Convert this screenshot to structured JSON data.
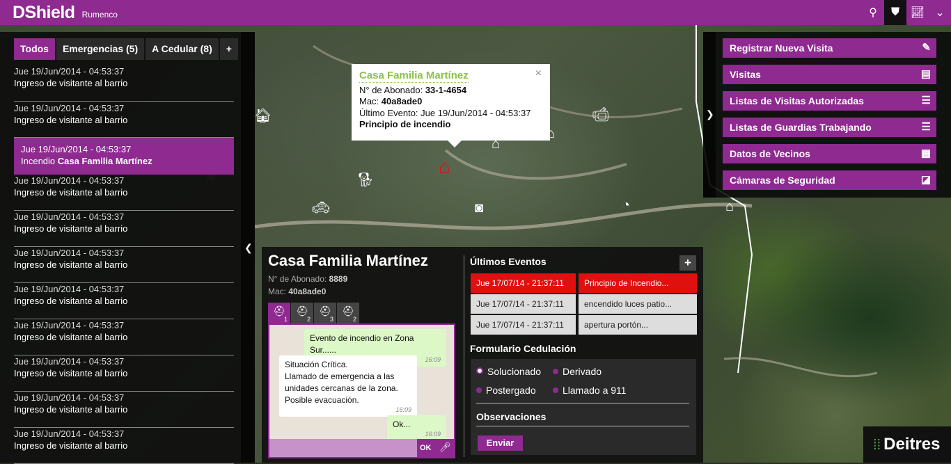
{
  "app": {
    "title": "DShield",
    "subtitle": "Rumenco"
  },
  "top_icons": [
    "location-pin-icon",
    "shield-badge-icon",
    "chart-line-icon",
    "chevron-down-icon"
  ],
  "tabs": [
    {
      "label": "Todos"
    },
    {
      "label": "Emergencias (5)"
    },
    {
      "label": "A Cedular (8)"
    },
    {
      "label": "+"
    }
  ],
  "events": [
    {
      "date": "Jue 19/Jun/2014 - 04:53:37",
      "text": "Ingreso de visitante al barrio"
    },
    {
      "date": "Jue 19/Jun/2014 - 04:53:37",
      "text": "Ingreso de visitante al barrio"
    },
    {
      "date": "Jue 19/Jun/2014 - 04:53:37",
      "text": "Incendio ",
      "strong": "Casa Familia Martínez"
    },
    {
      "date": "Jue 19/Jun/2014 - 04:53:37",
      "text": "Ingreso de visitante al barrio"
    },
    {
      "date": "Jue 19/Jun/2014 - 04:53:37",
      "text": "Ingreso de visitante al barrio"
    },
    {
      "date": "Jue 19/Jun/2014 - 04:53:37",
      "text": "Ingreso de visitante al barrio"
    },
    {
      "date": "Jue 19/Jun/2014 - 04:53:37",
      "text": "Ingreso de visitante al barrio"
    },
    {
      "date": "Jue 19/Jun/2014 - 04:53:37",
      "text": "Ingreso de visitante al barrio"
    },
    {
      "date": "Jue 19/Jun/2014 - 04:53:37",
      "text": "Ingreso de visitante al barrio"
    },
    {
      "date": "Jue 19/Jun/2014 - 04:53:37",
      "text": "Ingreso de visitante al barrio"
    },
    {
      "date": "Jue 19/Jun/2014 - 04:53:37",
      "text": "Ingreso de visitante al barrio"
    }
  ],
  "popup": {
    "title": "Casa Familia Martínez",
    "abonado_label": "N° de Abonado: ",
    "abonado": "33-1-4654",
    "mac_label": "Mac: ",
    "mac": "40a8ade0",
    "last_label": "Último Evento: Jue 19/Jun/2014 - 04:53:37",
    "last_event": "Principio de incendio",
    "close": "×"
  },
  "menu": [
    {
      "label": "Registrar Nueva Visita",
      "icon": "pencil-icon",
      "glyph": "✎"
    },
    {
      "label": "Visitas",
      "icon": "id-card-icon",
      "glyph": "▤"
    },
    {
      "label": "Listas de Visitas Autorizadas",
      "icon": "list-icon",
      "glyph": "☰"
    },
    {
      "label": "Listas de Guardias Trabajando",
      "icon": "list-icon",
      "glyph": "☰"
    },
    {
      "label": "Datos de Vecinos",
      "icon": "clipboard-icon",
      "glyph": "▦"
    },
    {
      "label": "Cámaras de Seguridad",
      "icon": "camera-icon",
      "glyph": "◪"
    }
  ],
  "detail": {
    "title": "Casa Familia Martínez",
    "abonado_label": "N° de Abonado: ",
    "abonado": "8889",
    "mac_label": "Mac: ",
    "mac": "40a8ade0"
  },
  "channel_tabs": [
    "1",
    "2",
    "3",
    "2"
  ],
  "chat": {
    "m1": {
      "text": "Evento de incendio en Zona Sur......",
      "time": "16:09"
    },
    "m2": {
      "l1": "Situación Crítica.",
      "l2": "Llamado de emergencia a las",
      "l3": "unidades cercanas de la zona.",
      "l4": "Posible evacuación.",
      "time": "16:09"
    },
    "m3": {
      "text": "Ok...",
      "time": "16:09"
    },
    "ok": "OK"
  },
  "ultimos": {
    "title": "Últimos Eventos",
    "add": "+",
    "rows": [
      {
        "date": "Jue 17/07/14 - 21:37:11",
        "desc": "Principio de Incendio..."
      },
      {
        "date": "Jue 17/07/14 - 21:37:11",
        "desc": "encendido luces patio..."
      },
      {
        "date": "Jue 17/07/14 - 21:37:11",
        "desc": "apertura portón..."
      }
    ]
  },
  "form": {
    "title": "Formulario Cedulación",
    "options": [
      "Solucionado",
      "Derivado",
      "Postergado",
      "Llamado a 911"
    ],
    "obs": "Observaciones",
    "send": "Enviar"
  },
  "logo": "Deitres",
  "colors": {
    "accent": "#8e2a90",
    "alert": "#e01010"
  }
}
